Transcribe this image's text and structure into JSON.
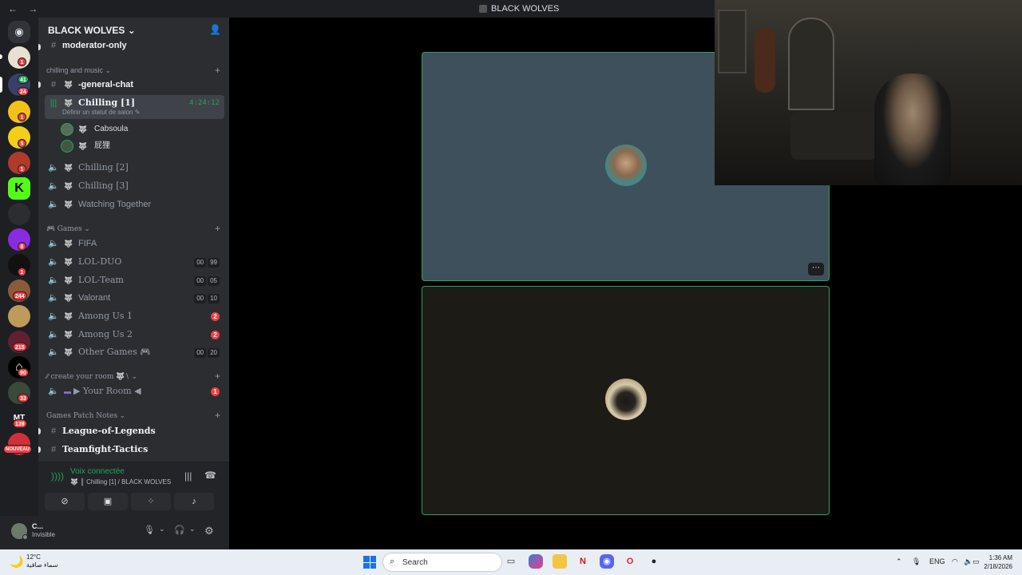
{
  "titlebar": {
    "title": "BLACK WOLVES",
    "back": "←",
    "forward": "→"
  },
  "rail": {
    "badges": [
      "1",
      "41",
      "24",
      "1",
      "5",
      "1",
      "",
      "",
      "8",
      "1",
      "244",
      "",
      "215",
      "90",
      "33",
      "139",
      "NOUVEAU"
    ]
  },
  "server": {
    "name": "BLACK WOLVES",
    "chevron": "⌄",
    "invite_icon": "👤"
  },
  "channels": {
    "moderator": "moderator-only",
    "cat_chill": "chilling and music",
    "general": "-general-chat",
    "chilling1": "Chilling [1]",
    "chilling1_timer": "4:24:12",
    "chilling1_status": "Définir un statut de salon",
    "users": [
      "Cabsoula",
      "屁狸"
    ],
    "chilling2": "Chilling [2]",
    "chilling3": "Chilling [3]",
    "watching": "Watching Together",
    "cat_games": "Games",
    "fifa": "FIFA",
    "lolduo": "LOL-DUO",
    "lolduo_c1": "00",
    "lolduo_c2": "99",
    "lolteam": "LOL-Team",
    "lolteam_c1": "00",
    "lolteam_c2": "05",
    "valorant": "Valorant",
    "valorant_c1": "00",
    "valorant_c2": "10",
    "among1": "Among Us 1",
    "among1_b": "2",
    "among2": "Among Us 2",
    "among2_b": "2",
    "other": "Other Games",
    "other_c1": "00",
    "other_c2": "20",
    "cat_room": "create your room",
    "yourroom": "▶ Your Room ◀",
    "yourroom_b": "1",
    "cat_patch": "Games Patch Notes",
    "lol": "League-of-Legends",
    "tft": "Teamfight-Tactics"
  },
  "voice": {
    "connected": "Voix connectée",
    "sub": "Chilling [1] / BLACK WOLVES"
  },
  "user": {
    "name": "C...",
    "status": "Invisible"
  },
  "taskbar": {
    "temp": "12°C",
    "weather": "سماء صافية",
    "search": "Search",
    "lang": "ENG",
    "time": "1:36 AM",
    "date": "2/18/2026"
  },
  "colors": {
    "green": "#23a55a",
    "red": "#f23f43",
    "sidebar": "#2b2d31",
    "rail": "#1e1f22"
  }
}
